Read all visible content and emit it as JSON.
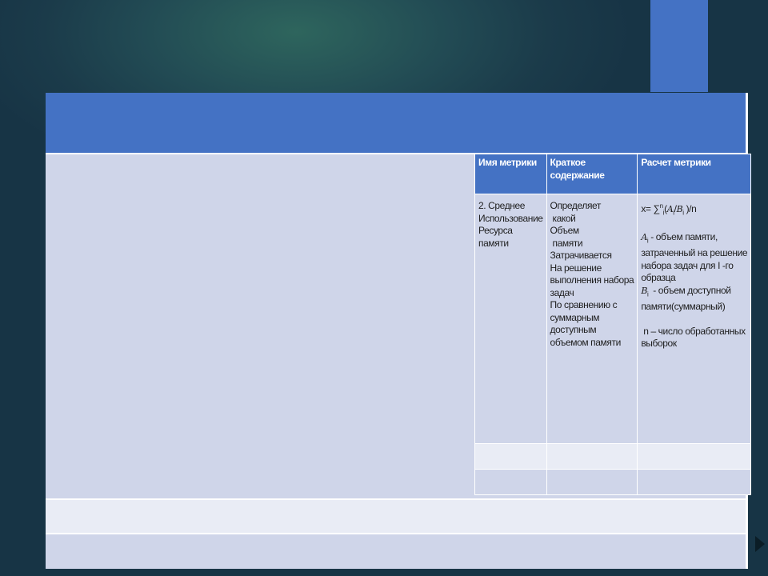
{
  "table": {
    "headers": [
      "Имя метрики",
      "Краткое содержание",
      "Расчет метрики"
    ],
    "row1": {
      "name": "2. Среднее Использование Ресурса памяти",
      "description": "Определяет какой Объем памяти Затрачивается На решение выполнения набора задач По сравнению с суммарным доступным объемом памяти",
      "formula": "x= ∑ⁿᵢ(Aᵢ/Bᵢ )/n",
      "a_def": "Aᵢ - объем памяти, затраченный на решение набора задач для I -го образца",
      "b_def": "Bᵢ - объем доступной памяти(суммарный)",
      "n_def": "n – число обработанных выборок"
    }
  },
  "colors": {
    "accent": "#4472c4",
    "cell_dark": "#cfd5e9",
    "cell_light": "#e9ecf5",
    "background": "#1b3b4a"
  }
}
